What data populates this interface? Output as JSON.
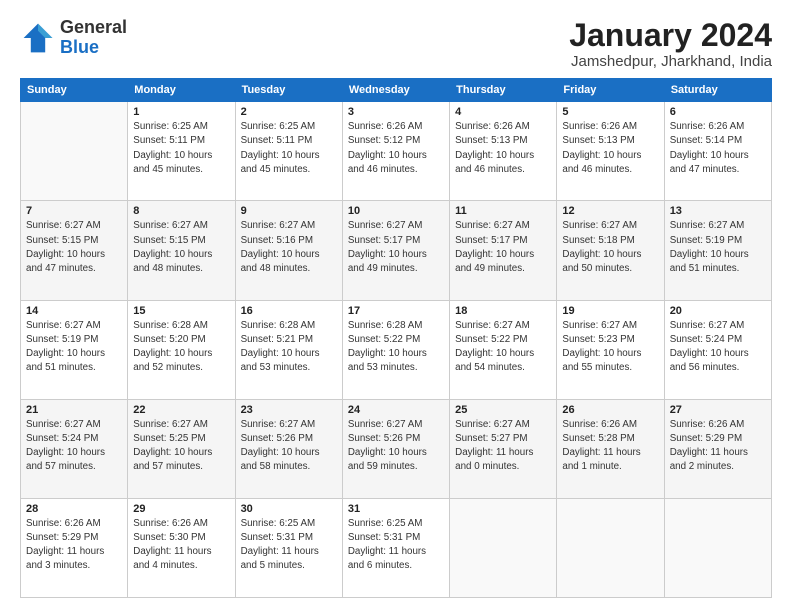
{
  "logo": {
    "general": "General",
    "blue": "Blue"
  },
  "header": {
    "month": "January 2024",
    "location": "Jamshedpur, Jharkhand, India"
  },
  "weekdays": [
    "Sunday",
    "Monday",
    "Tuesday",
    "Wednesday",
    "Thursday",
    "Friday",
    "Saturday"
  ],
  "weeks": [
    [
      {
        "day": "",
        "info": ""
      },
      {
        "day": "1",
        "info": "Sunrise: 6:25 AM\nSunset: 5:11 PM\nDaylight: 10 hours\nand 45 minutes."
      },
      {
        "day": "2",
        "info": "Sunrise: 6:25 AM\nSunset: 5:11 PM\nDaylight: 10 hours\nand 45 minutes."
      },
      {
        "day": "3",
        "info": "Sunrise: 6:26 AM\nSunset: 5:12 PM\nDaylight: 10 hours\nand 46 minutes."
      },
      {
        "day": "4",
        "info": "Sunrise: 6:26 AM\nSunset: 5:13 PM\nDaylight: 10 hours\nand 46 minutes."
      },
      {
        "day": "5",
        "info": "Sunrise: 6:26 AM\nSunset: 5:13 PM\nDaylight: 10 hours\nand 46 minutes."
      },
      {
        "day": "6",
        "info": "Sunrise: 6:26 AM\nSunset: 5:14 PM\nDaylight: 10 hours\nand 47 minutes."
      }
    ],
    [
      {
        "day": "7",
        "info": "Sunrise: 6:27 AM\nSunset: 5:15 PM\nDaylight: 10 hours\nand 47 minutes."
      },
      {
        "day": "8",
        "info": "Sunrise: 6:27 AM\nSunset: 5:15 PM\nDaylight: 10 hours\nand 48 minutes."
      },
      {
        "day": "9",
        "info": "Sunrise: 6:27 AM\nSunset: 5:16 PM\nDaylight: 10 hours\nand 48 minutes."
      },
      {
        "day": "10",
        "info": "Sunrise: 6:27 AM\nSunset: 5:17 PM\nDaylight: 10 hours\nand 49 minutes."
      },
      {
        "day": "11",
        "info": "Sunrise: 6:27 AM\nSunset: 5:17 PM\nDaylight: 10 hours\nand 49 minutes."
      },
      {
        "day": "12",
        "info": "Sunrise: 6:27 AM\nSunset: 5:18 PM\nDaylight: 10 hours\nand 50 minutes."
      },
      {
        "day": "13",
        "info": "Sunrise: 6:27 AM\nSunset: 5:19 PM\nDaylight: 10 hours\nand 51 minutes."
      }
    ],
    [
      {
        "day": "14",
        "info": "Sunrise: 6:27 AM\nSunset: 5:19 PM\nDaylight: 10 hours\nand 51 minutes."
      },
      {
        "day": "15",
        "info": "Sunrise: 6:28 AM\nSunset: 5:20 PM\nDaylight: 10 hours\nand 52 minutes."
      },
      {
        "day": "16",
        "info": "Sunrise: 6:28 AM\nSunset: 5:21 PM\nDaylight: 10 hours\nand 53 minutes."
      },
      {
        "day": "17",
        "info": "Sunrise: 6:28 AM\nSunset: 5:22 PM\nDaylight: 10 hours\nand 53 minutes."
      },
      {
        "day": "18",
        "info": "Sunrise: 6:27 AM\nSunset: 5:22 PM\nDaylight: 10 hours\nand 54 minutes."
      },
      {
        "day": "19",
        "info": "Sunrise: 6:27 AM\nSunset: 5:23 PM\nDaylight: 10 hours\nand 55 minutes."
      },
      {
        "day": "20",
        "info": "Sunrise: 6:27 AM\nSunset: 5:24 PM\nDaylight: 10 hours\nand 56 minutes."
      }
    ],
    [
      {
        "day": "21",
        "info": "Sunrise: 6:27 AM\nSunset: 5:24 PM\nDaylight: 10 hours\nand 57 minutes."
      },
      {
        "day": "22",
        "info": "Sunrise: 6:27 AM\nSunset: 5:25 PM\nDaylight: 10 hours\nand 57 minutes."
      },
      {
        "day": "23",
        "info": "Sunrise: 6:27 AM\nSunset: 5:26 PM\nDaylight: 10 hours\nand 58 minutes."
      },
      {
        "day": "24",
        "info": "Sunrise: 6:27 AM\nSunset: 5:26 PM\nDaylight: 10 hours\nand 59 minutes."
      },
      {
        "day": "25",
        "info": "Sunrise: 6:27 AM\nSunset: 5:27 PM\nDaylight: 11 hours\nand 0 minutes."
      },
      {
        "day": "26",
        "info": "Sunrise: 6:26 AM\nSunset: 5:28 PM\nDaylight: 11 hours\nand 1 minute."
      },
      {
        "day": "27",
        "info": "Sunrise: 6:26 AM\nSunset: 5:29 PM\nDaylight: 11 hours\nand 2 minutes."
      }
    ],
    [
      {
        "day": "28",
        "info": "Sunrise: 6:26 AM\nSunset: 5:29 PM\nDaylight: 11 hours\nand 3 minutes."
      },
      {
        "day": "29",
        "info": "Sunrise: 6:26 AM\nSunset: 5:30 PM\nDaylight: 11 hours\nand 4 minutes."
      },
      {
        "day": "30",
        "info": "Sunrise: 6:25 AM\nSunset: 5:31 PM\nDaylight: 11 hours\nand 5 minutes."
      },
      {
        "day": "31",
        "info": "Sunrise: 6:25 AM\nSunset: 5:31 PM\nDaylight: 11 hours\nand 6 minutes."
      },
      {
        "day": "",
        "info": ""
      },
      {
        "day": "",
        "info": ""
      },
      {
        "day": "",
        "info": ""
      }
    ]
  ]
}
